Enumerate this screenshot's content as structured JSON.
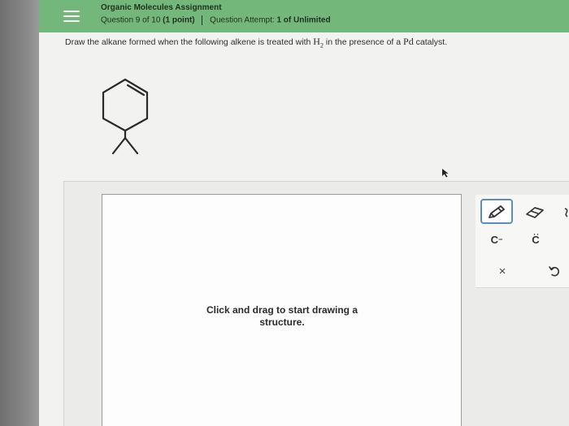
{
  "header": {
    "app_title": "Organic Molecules Assignment",
    "question_label": "Question 9 of 10",
    "points": "(1 point)",
    "attempt_label": "Question Attempt:",
    "attempt_value": "1 of Unlimited",
    "background_color": "#74b77a"
  },
  "question": {
    "prompt_start": "Draw the alkane formed when the following alkene is treated with",
    "h2_base": "H",
    "h2_sub": "2",
    "prompt_mid": "in the presence of a",
    "catalyst": "Pd",
    "prompt_end": "catalyst."
  },
  "molecule": {
    "icon": "alkene-structure"
  },
  "drawing": {
    "hint": "Click and drag to start drawing a structure."
  },
  "toolbar": {
    "tools": [
      {
        "name": "pencil",
        "icon": "pencil-icon",
        "active": true
      },
      {
        "name": "eraser",
        "icon": "eraser-icon"
      },
      {
        "name": "anion",
        "label": "C",
        "superscript": "−"
      },
      {
        "name": "carbene",
        "label": "C"
      },
      {
        "name": "clear",
        "label": "×"
      },
      {
        "name": "undo",
        "icon": "undo-icon"
      }
    ],
    "accent_color": "#5b8fb8"
  }
}
